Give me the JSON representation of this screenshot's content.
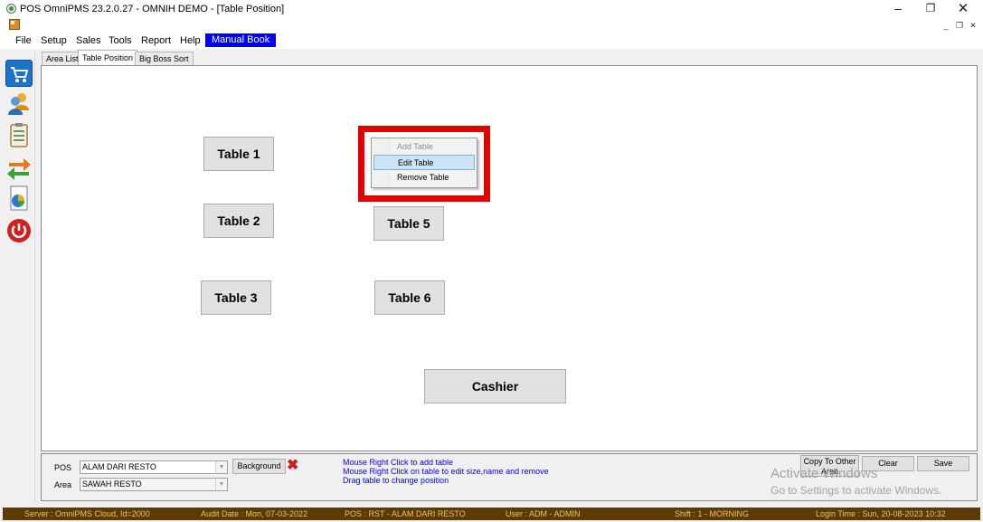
{
  "window": {
    "title": "POS OmniPMS 23.2.0.27 - OMNIH DEMO - [Table Position]",
    "minimize": "–",
    "restore": "❐",
    "close": "✕"
  },
  "mdi": {
    "minimize": "_",
    "restore": "❐",
    "close": "✕"
  },
  "menu": {
    "items": [
      "File",
      "Setup",
      "Sales",
      "Tools",
      "Report",
      "Help"
    ],
    "highlight": "Manual Book"
  },
  "toolbar": {
    "icons": [
      "cart-icon",
      "users-icon",
      "clipboard-icon",
      "transfer-icon",
      "report-icon",
      "power-icon"
    ]
  },
  "tabs": [
    "Area List",
    "Table Position",
    "Big Boss Sort"
  ],
  "active_tab": "Table Position",
  "tables": [
    "Table 1",
    "Table 2",
    "Table 3",
    "Table 5",
    "Table 6",
    "Cashier"
  ],
  "context_menu": {
    "items": [
      "Add Table",
      "Edit Table",
      "Remove Table"
    ],
    "disabled": "Add Table",
    "selected": "Edit Table",
    "highlight_color": "#e30000"
  },
  "bottom": {
    "pos_label": "POS",
    "pos_value": "ALAM DARI RESTO",
    "area_label": "Area",
    "area_value": "SAWAH RESTO",
    "background_button": "Background",
    "remove_background_icon": "red-x-icon",
    "hints": [
      "Mouse Right Click to add table",
      "Mouse Right Click on table to edit size,name and remove",
      "Drag table to change position"
    ],
    "hint_color": "#0000ff",
    "copy_button": "Copy To Other Area",
    "clear_button": "Clear",
    "save_button": "Save"
  },
  "watermark": {
    "line1": "Activate Windows",
    "line2": "Go to Settings to activate Windows."
  },
  "status": {
    "server": "Server : OmniPMS Cloud, Id=2000",
    "audit_date": "Audit Date : Mon, 07-03-2022",
    "pos": "POS : RST - ALAM DARI RESTO",
    "user": "User : ADM - ADMIN",
    "shift": "Shift : 1 - MORNING",
    "login_time": "Login Time : Sun, 20-08-2023 10:32",
    "background": "#5c3a06",
    "text_color": "#f3c35a"
  }
}
